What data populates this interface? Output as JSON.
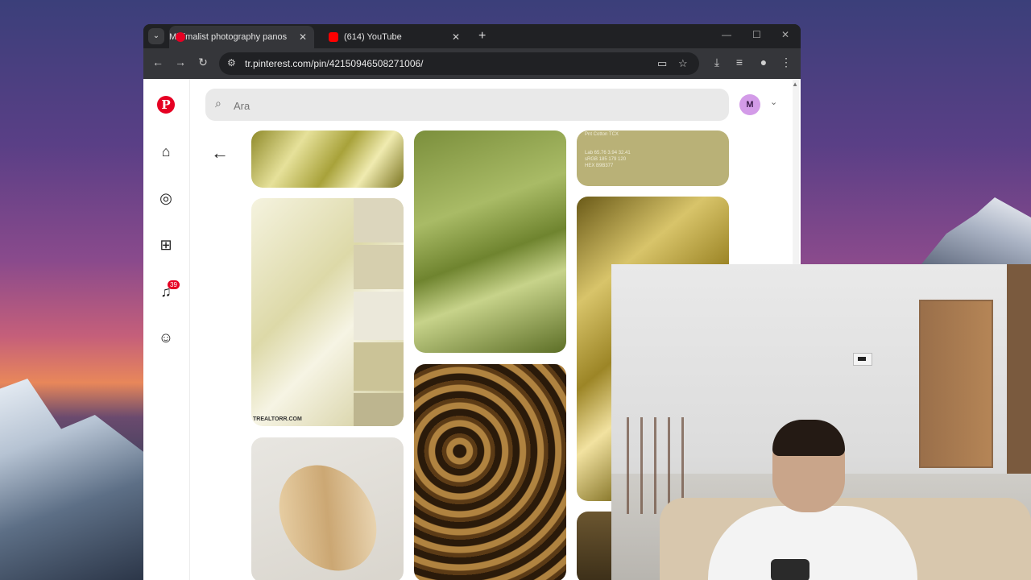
{
  "browser": {
    "tabs": [
      {
        "title": "Minimalist photography panos",
        "favicon": "pinterest-icon",
        "active": true
      },
      {
        "title": "(614) YouTube",
        "favicon": "youtube-icon",
        "active": false
      }
    ],
    "new_tab_icon": "+",
    "url": "tr.pinterest.com/pin/42150946508271006/"
  },
  "pinterest": {
    "logo": "P",
    "search_placeholder": "Ara",
    "avatar_initial": "M",
    "notifications_count": "39",
    "nav": [
      "home-icon",
      "explore-icon",
      "create-icon",
      "notifications-icon",
      "messages-icon"
    ]
  },
  "pins": {
    "p2_watermark": "TREALTORR.COM",
    "p5_lines": [
      "Pnt Cotton TCX",
      "Lab    65.76  3.94  32.41",
      "sRGB   185  179  120",
      "HEX    B9B377"
    ]
  },
  "colors": {
    "pinterest_red": "#e60023",
    "browser_dark": "#202124",
    "browser_toolbar": "#35363a"
  }
}
